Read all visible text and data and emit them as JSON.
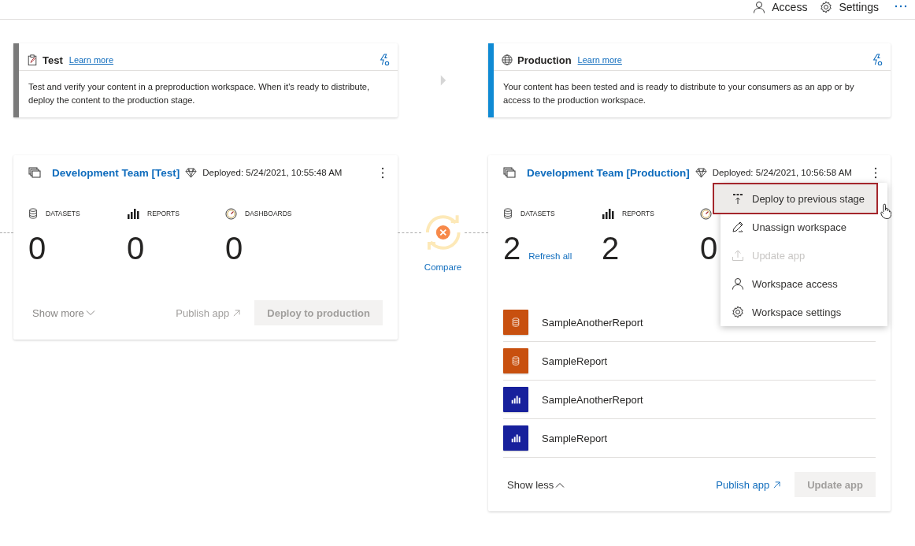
{
  "top_bar": {
    "items": [
      {
        "kind": "access",
        "label": "Access"
      },
      {
        "kind": "settings",
        "label": "Settings"
      },
      {
        "kind": "more"
      }
    ]
  },
  "stages": [
    {
      "kind": "test",
      "name": "Test",
      "link": "Learn more",
      "color": "#7a7a7a",
      "description": "Test and verify your content in a preproduction workspace. When it's ready to distribute, deploy the content to the production stage."
    },
    {
      "kind": "production",
      "name": "Production",
      "link": "Learn more",
      "color": "#0f8ad4",
      "description": "Your content has been tested and is ready to distribute to your consumers as an app or by access to the production workspace."
    }
  ],
  "compare": {
    "label": "Compare"
  },
  "workspaces": [
    {
      "title": "Development Team [Test]",
      "deployed": "Deployed: 5/24/2021, 10:55:48 AM",
      "stats": [
        {
          "kind": "datasets",
          "label": "DATASETS",
          "value": "0"
        },
        {
          "kind": "reports",
          "label": "REPORTS",
          "value": "0"
        },
        {
          "kind": "dashboards",
          "label": "DASHBOARDS",
          "value": "0"
        }
      ],
      "toggle": "Show more",
      "expanded": false,
      "publish": "Publish app",
      "publish_disabled": true,
      "primary": "Deploy to production",
      "primary_disabled": true
    },
    {
      "title": "Development Team [Production]",
      "deployed": "Deployed: 5/24/2021, 10:56:58 AM",
      "stats": [
        {
          "kind": "datasets",
          "label": "DATASETS",
          "value": "2",
          "action": "Refresh all"
        },
        {
          "kind": "reports",
          "label": "REPORTS",
          "value": "2"
        },
        {
          "kind": "dashboards",
          "value": "0"
        }
      ],
      "items": [
        {
          "kind": "dataset",
          "name": "SampleAnotherReport"
        },
        {
          "kind": "dataset",
          "name": "SampleReport"
        },
        {
          "kind": "report",
          "name": "SampleAnotherReport"
        },
        {
          "kind": "report",
          "name": "SampleReport"
        }
      ],
      "toggle": "Show less",
      "expanded": true,
      "publish": "Publish app",
      "publish_disabled": false,
      "primary": "Update app",
      "primary_disabled": true
    }
  ],
  "menu": {
    "items": [
      {
        "kind": "deploy",
        "label": "Deploy to previous stage",
        "selected": true,
        "disabled": false
      },
      {
        "kind": "unassign",
        "label": "Unassign workspace",
        "selected": false,
        "disabled": false
      },
      {
        "kind": "upload",
        "label": "Update app",
        "selected": false,
        "disabled": true
      },
      {
        "kind": "access",
        "label": "Workspace access",
        "selected": false,
        "disabled": false
      },
      {
        "kind": "settings",
        "label": "Workspace settings",
        "selected": false,
        "disabled": false
      }
    ]
  }
}
